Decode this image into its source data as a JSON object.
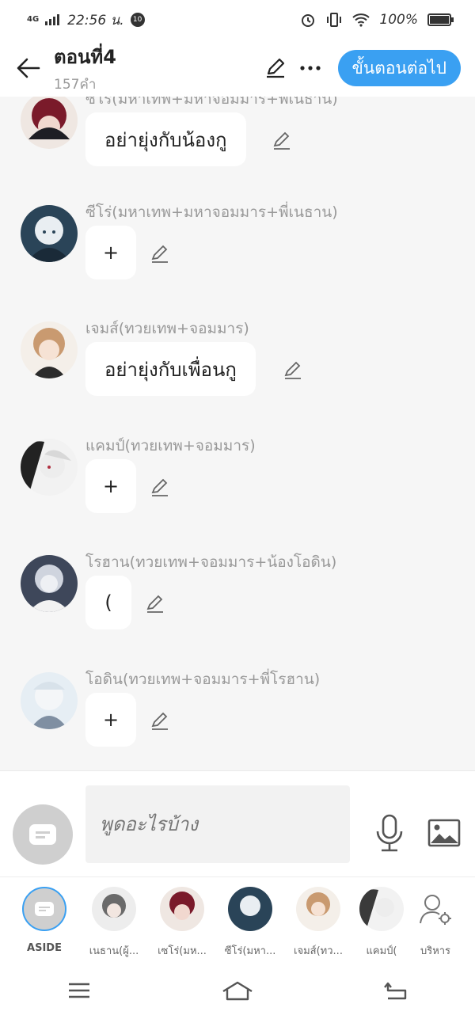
{
  "status": {
    "network": "4G",
    "time": "22:56 น.",
    "notif_badge": "10",
    "battery": "100%",
    "icons": [
      "alarm-icon",
      "vibrate-icon",
      "wifi-icon",
      "battery-icon"
    ]
  },
  "header": {
    "title": "ตอนที่4",
    "subtitle": "157คำ",
    "next_label": "ขั้นตอนต่อไป",
    "icons": [
      "back-arrow-icon",
      "pencil-icon",
      "more-icon"
    ]
  },
  "messages": [
    {
      "name": "ซีโร่(มหาเทพ+มหาจอมมาร+พี่เนธาน)",
      "text": "อย่ายุ่งกับน้องกู",
      "avatar_color": "#7a1a2a"
    },
    {
      "name": "ซีโร่(มหาเทพ+มหาจอมมาร+พี่เนธาน)",
      "text": "+",
      "avatar_color": "#2a4458"
    },
    {
      "name": "เจมส์(ทวยเทพ+จอมมาร)",
      "text": "อย่ายุ่งกับเพื่อนกู",
      "avatar_color": "#c99a70"
    },
    {
      "name": "แคมป์(ทวยเทพ+จอมมาร)",
      "text": "+",
      "avatar_color": "#3a3a3a"
    },
    {
      "name": "โรฮาน(ทวยเทพ+จอมมาร+น้องโอดิน)",
      "text": "(",
      "avatar_color": "#5a6478"
    },
    {
      "name": "โอดิน(ทวยเทพ+จอมมาร+พี่โรฮาน)",
      "text": "+",
      "avatar_color": "#a8b8c8"
    }
  ],
  "composer": {
    "placeholder": "พูดอะไรบ้าง",
    "icons": [
      "aside-icon",
      "microphone-icon",
      "image-icon"
    ]
  },
  "characters": [
    {
      "label": "ASIDE",
      "color": "#cfcfcf"
    },
    {
      "label": "เนธาน(ผู้...",
      "color": "#6a6a6a"
    },
    {
      "label": "เซโร่(มห...",
      "color": "#7a1a2a"
    },
    {
      "label": "ซีโร่(มหา...",
      "color": "#2a4458"
    },
    {
      "label": "เจมส์(ทว...",
      "color": "#c99a70"
    },
    {
      "label": "แคมป์(",
      "color": "#3a3a3a"
    },
    {
      "label": "บริหาร",
      "color": "#ffffff"
    }
  ],
  "navbar": {
    "icons": [
      "menu-icon",
      "home-icon",
      "back-icon"
    ]
  }
}
